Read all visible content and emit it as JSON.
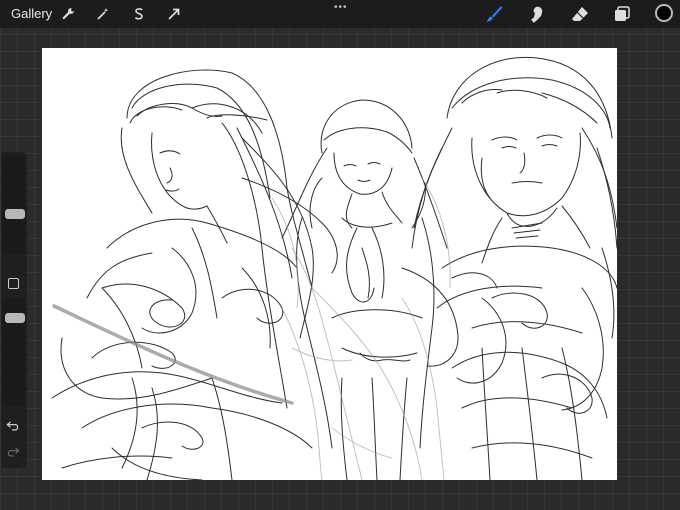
{
  "topbar": {
    "gallery_label": "Gallery",
    "left_tools": [
      {
        "icon": "wrench-icon"
      },
      {
        "icon": "magic-wand-icon"
      },
      {
        "icon": "selection-s-icon"
      },
      {
        "icon": "transform-arrow-icon"
      }
    ],
    "center_menu": "•••",
    "right_tools": [
      {
        "icon": "brush-icon",
        "active": true
      },
      {
        "icon": "smudge-icon"
      },
      {
        "icon": "eraser-icon"
      },
      {
        "icon": "layers-icon"
      }
    ],
    "current_color": "#000000",
    "accent_color": "#2f7cf6"
  },
  "sidebar": {
    "brush_size_level": 0.4,
    "opacity_level": 0.85,
    "undo_icon": "undo-icon",
    "redo_icon": "redo-icon"
  },
  "canvas": {
    "background": "#ffffff",
    "content": "sketch-artwork"
  }
}
